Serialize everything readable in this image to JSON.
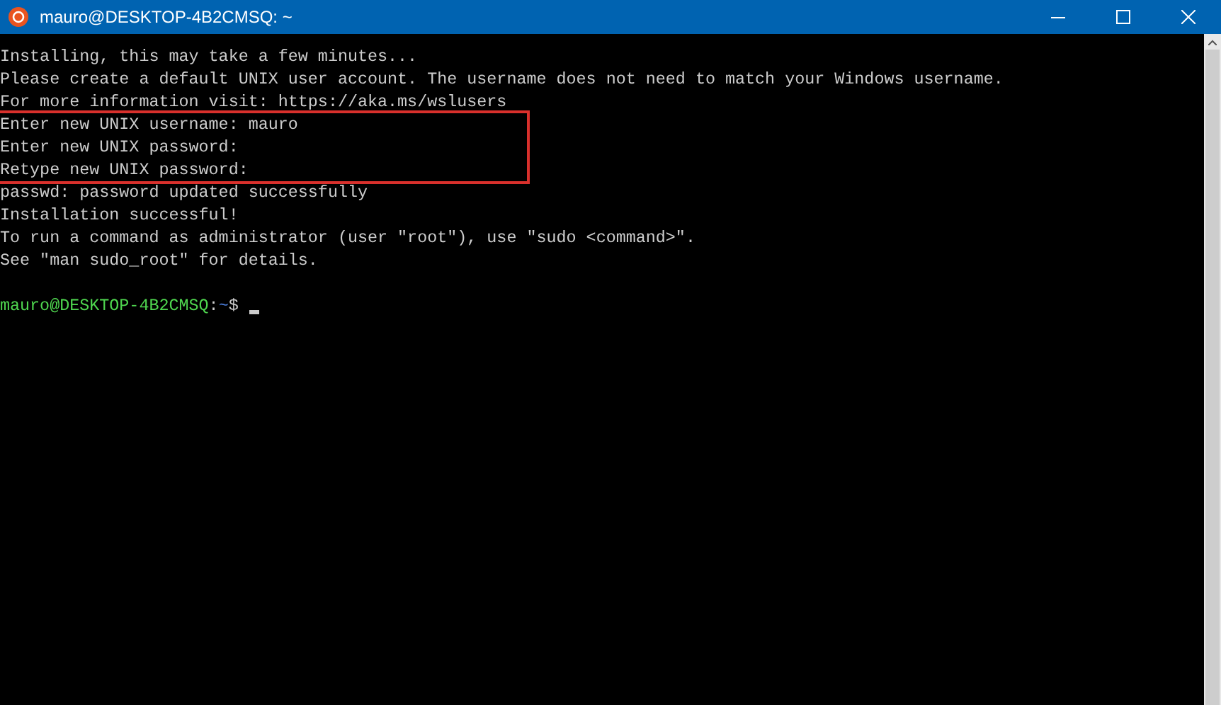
{
  "window": {
    "title": "mauro@DESKTOP-4B2CMSQ: ~"
  },
  "output": [
    {
      "text": "Installing, this may take a few minutes...",
      "highlighted": false
    },
    {
      "text": "Please create a default UNIX user account. The username does not need to match your Windows username.",
      "highlighted": false
    },
    {
      "text": "For more information visit: https://aka.ms/wslusers",
      "highlighted": false
    },
    {
      "text": "Enter new UNIX username: mauro",
      "highlighted": true
    },
    {
      "text": "Enter new UNIX password:",
      "highlighted": true
    },
    {
      "text": "Retype new UNIX password:",
      "highlighted": true
    },
    {
      "text": "passwd: password updated successfully",
      "highlighted": false
    },
    {
      "text": "Installation successful!",
      "highlighted": false
    },
    {
      "text": "To run a command as administrator (user \"root\"), use \"sudo <command>\".",
      "highlighted": false
    },
    {
      "text": "See \"man sudo_root\" for details.",
      "highlighted": false
    }
  ],
  "prompt": {
    "user_host": "mauro@DESKTOP-4B2CMSQ",
    "separator": ":",
    "path": "~",
    "symbol": "$"
  }
}
